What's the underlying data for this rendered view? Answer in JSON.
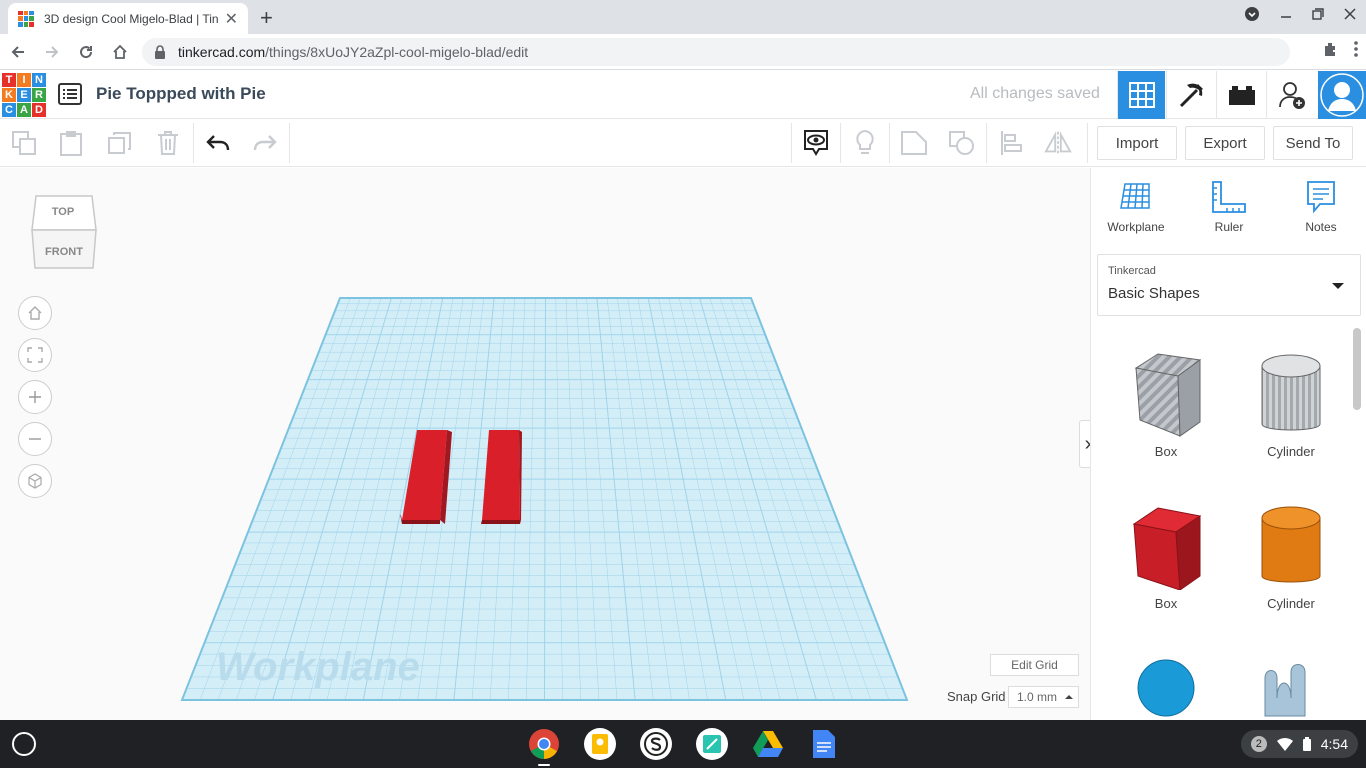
{
  "browser": {
    "tab_title": "3D design Cool Migelo-Blad | Tin",
    "new_tab": "+",
    "url_host": "tinkercad.com",
    "url_path": "/things/8xUoJY2aZpl-cool-migelo-blad/edit"
  },
  "header": {
    "logo_letters": [
      "T",
      "I",
      "N",
      "K",
      "E",
      "R",
      "C",
      "A",
      "D"
    ],
    "design_title": "Pie Toppped with Pie",
    "save_status": "All changes saved"
  },
  "toolbar": {
    "import_label": "Import",
    "export_label": "Export",
    "send_to_label": "Send To"
  },
  "viewcube": {
    "top_label": "TOP",
    "front_label": "FRONT"
  },
  "workplane": {
    "label": "Workplane",
    "edit_grid_label": "Edit Grid",
    "snap_grid_label": "Snap Grid",
    "snap_grid_value": "1.0 mm"
  },
  "panel": {
    "tools": [
      {
        "label": "Workplane"
      },
      {
        "label": "Ruler"
      },
      {
        "label": "Notes"
      }
    ],
    "library_category": "Tinkercad",
    "library_name": "Basic Shapes",
    "shapes": [
      {
        "label": "Box"
      },
      {
        "label": "Cylinder"
      },
      {
        "label": "Box"
      },
      {
        "label": "Cylinder"
      }
    ]
  },
  "shelf": {
    "notification_count": "2",
    "time": "4:54"
  },
  "colors": {
    "accent": "#2a8fe0",
    "object_red": "#d9202a",
    "grid_blue": "#9fd3ea"
  }
}
